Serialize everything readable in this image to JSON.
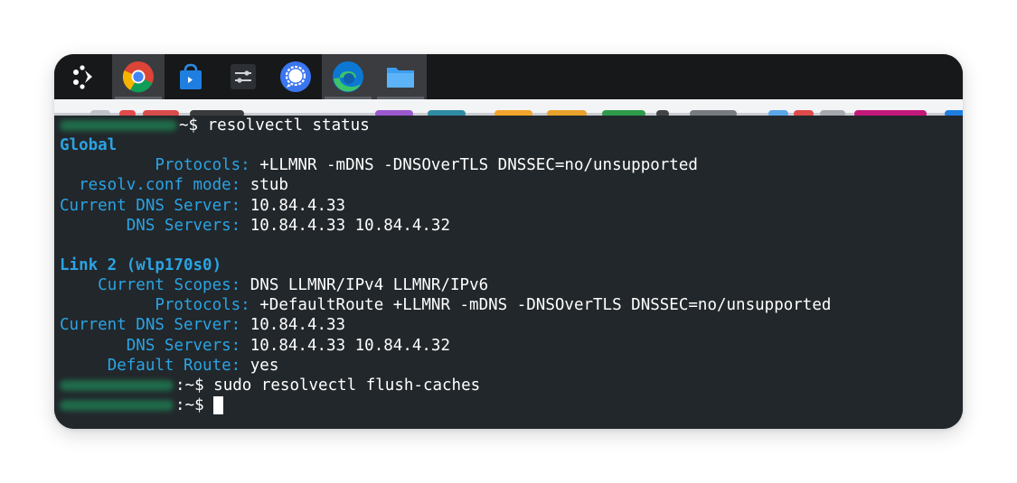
{
  "taskbar": {
    "apps": [
      {
        "icon": "app-launcher-icon"
      },
      {
        "icon": "chrome-icon"
      },
      {
        "icon": "store-icon"
      },
      {
        "icon": "settings-sliders-icon"
      },
      {
        "icon": "signal-icon"
      },
      {
        "icon": "edge-icon"
      },
      {
        "icon": "files-icon"
      }
    ]
  },
  "terminal": {
    "prompt_suffix": "~$",
    "prompt_suffix_colon": ":~$",
    "cmd1": "resolvectl status",
    "global": {
      "header": "Global",
      "protocols_label": "Protocols:",
      "protocols_value": "+LLMNR -mDNS -DNSOverTLS DNSSEC=no/unsupported",
      "resolv_label": "resolv.conf mode:",
      "resolv_value": "stub",
      "current_dns_label": "Current DNS Server:",
      "current_dns_value": "10.84.4.33",
      "dns_servers_label": "DNS Servers:",
      "dns_servers_value": "10.84.4.33 10.84.4.32"
    },
    "link": {
      "header": "Link 2 (wlp170s0)",
      "scopes_label": "Current Scopes:",
      "scopes_value": "DNS LLMNR/IPv4 LLMNR/IPv6",
      "protocols_label": "Protocols:",
      "protocols_value": "+DefaultRoute +LLMNR -mDNS -DNSOverTLS DNSSEC=no/unsupported",
      "current_dns_label": "Current DNS Server:",
      "current_dns_value": "10.84.4.33",
      "dns_servers_label": "DNS Servers:",
      "dns_servers_value": "10.84.4.33 10.84.4.32",
      "default_route_label": "Default Route:",
      "default_route_value": "yes"
    },
    "cmd2": "sudo resolvectl flush-caches"
  },
  "colors": {
    "terminal_bg": "#22272b",
    "label": "#2ba3e3",
    "taskbar_bg": "#17181a"
  }
}
